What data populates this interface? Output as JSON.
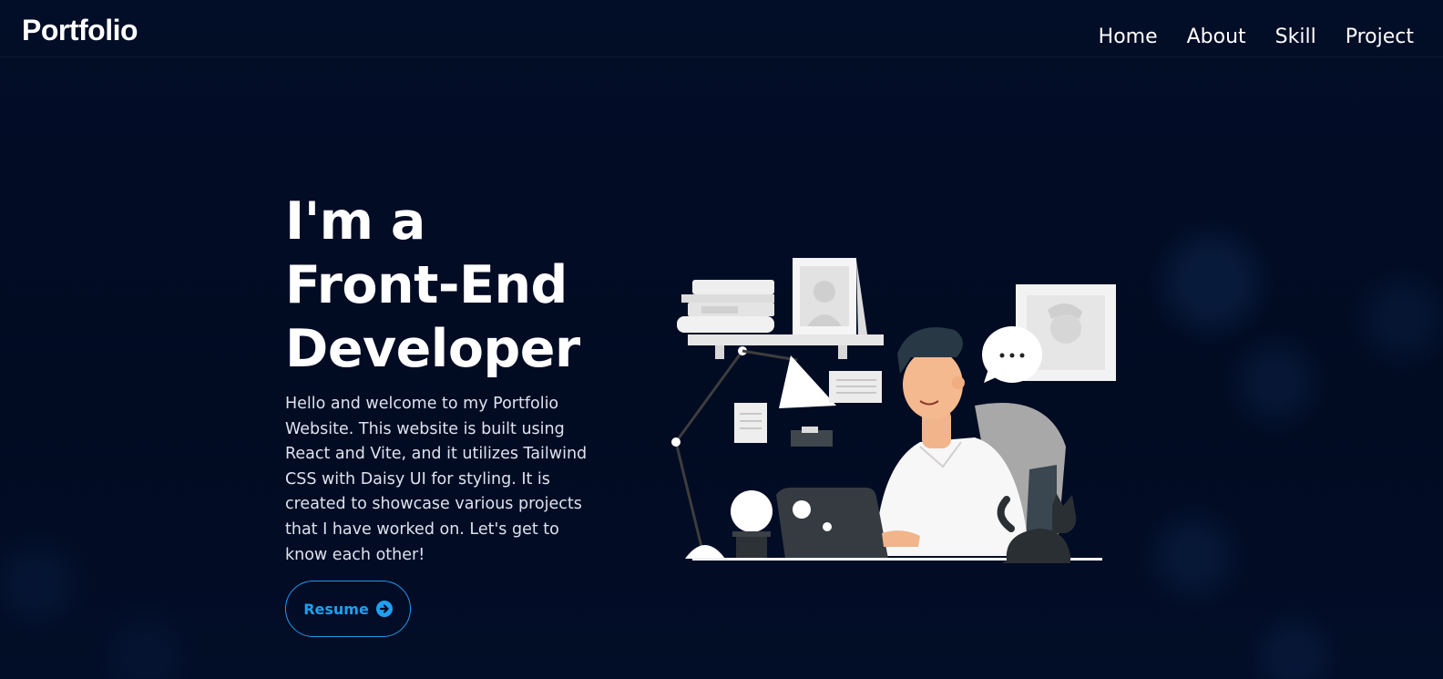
{
  "app": {
    "logo": "Portfolio"
  },
  "nav": {
    "items": [
      {
        "label": "Home"
      },
      {
        "label": "About"
      },
      {
        "label": "Skill"
      },
      {
        "label": "Project"
      }
    ]
  },
  "hero": {
    "headline_line1": "I'm a",
    "headline_line2": "Front-End",
    "headline_line3": "Developer",
    "description": "Hello and welcome to my Portfolio Website. This website is built using React and Vite, and it utilizes Tailwind CSS with Daisy UI for styling. It is created to showcase various projects that I have worked on. Let's get to know each other!",
    "resume_label": "Resume",
    "resume_icon": "arrow-right-circle-icon",
    "illustration": "developer-at-desk-illustration"
  },
  "colors": {
    "background": "#010c25",
    "accent": "#1d9bf0",
    "text": "#ffffff"
  }
}
